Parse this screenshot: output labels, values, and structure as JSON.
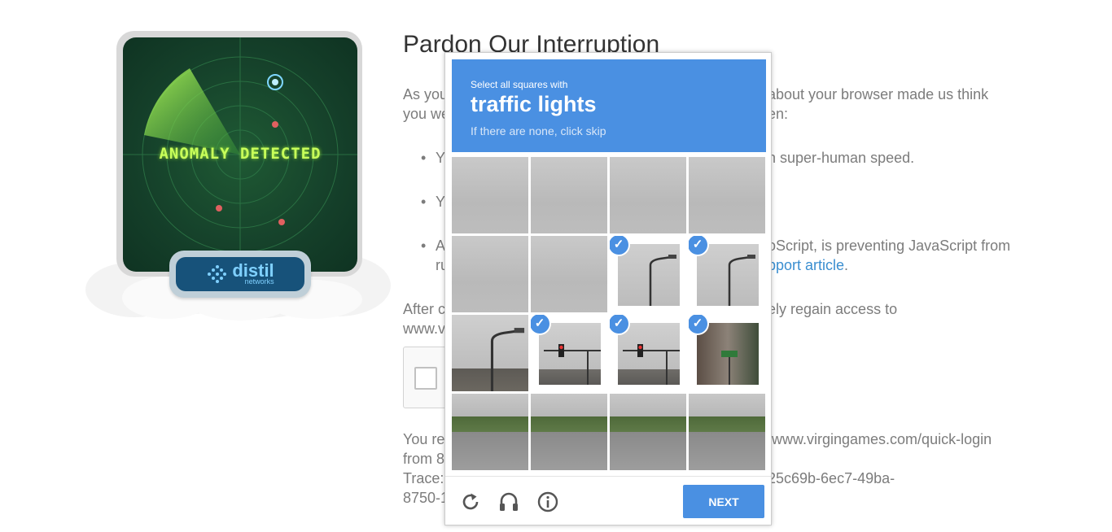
{
  "illustration": {
    "radar_text": "ANOMALY DETECTED",
    "logo_text": "distil",
    "logo_subtext": "networks",
    "colors": {
      "radar_bg": "#15402a",
      "radar_text": "#c8ff5a",
      "badge": "#17527a"
    }
  },
  "page": {
    "title": "Pardon Our Interruption",
    "para1_line1_left": "As you",
    "para1_line1_right": "about your browser made us think",
    "para1_line2_left": "you we",
    "para1_line2_right": "en:",
    "bullet1_left": "Y",
    "bullet1_right": "h super-human speed.",
    "bullet2_left": "Y",
    "bullet3_left": "A",
    "bullet3_right": "oScript, is preventing JavaScript from",
    "bullet3_line2_left": "ru",
    "bullet3_link": "pport article",
    "bullet3_end": ".",
    "para2_line1_left": "After c",
    "para2_line1_right": "ely regain access to",
    "para2_line2_left": "www.v",
    "para3_line1_left": "You re",
    "para3_line1_right": "/www.virgingames.com/quick-login",
    "para3_line2_left": "from 8",
    "para3_line3_left": "Trace:",
    "para3_line3_right": "25c69b-6ec7-49ba-",
    "para3_line4_left": "8750-1"
  },
  "captcha": {
    "instruction": "Select all squares with",
    "target": "traffic lights",
    "hint": "If there are none, click skip",
    "next_label": "NEXT",
    "accent": "#4a90e2",
    "tiles": [
      {
        "scene": "sky",
        "selected": false
      },
      {
        "scene": "sky",
        "selected": false
      },
      {
        "scene": "sky",
        "selected": false
      },
      {
        "scene": "sky",
        "selected": false
      },
      {
        "scene": "sky",
        "selected": false
      },
      {
        "scene": "sky",
        "selected": false
      },
      {
        "scene": "streetlight",
        "selected": true
      },
      {
        "scene": "streetlight",
        "selected": true
      },
      {
        "scene": "streetlight-city",
        "selected": false
      },
      {
        "scene": "traffic-light",
        "selected": true
      },
      {
        "scene": "traffic-light",
        "selected": true
      },
      {
        "scene": "building-sign",
        "selected": true
      },
      {
        "scene": "street",
        "selected": false
      },
      {
        "scene": "street",
        "selected": false
      },
      {
        "scene": "street",
        "selected": false
      },
      {
        "scene": "street",
        "selected": false
      }
    ],
    "footer_icons": [
      "reload-icon",
      "audio-icon",
      "info-icon"
    ]
  }
}
